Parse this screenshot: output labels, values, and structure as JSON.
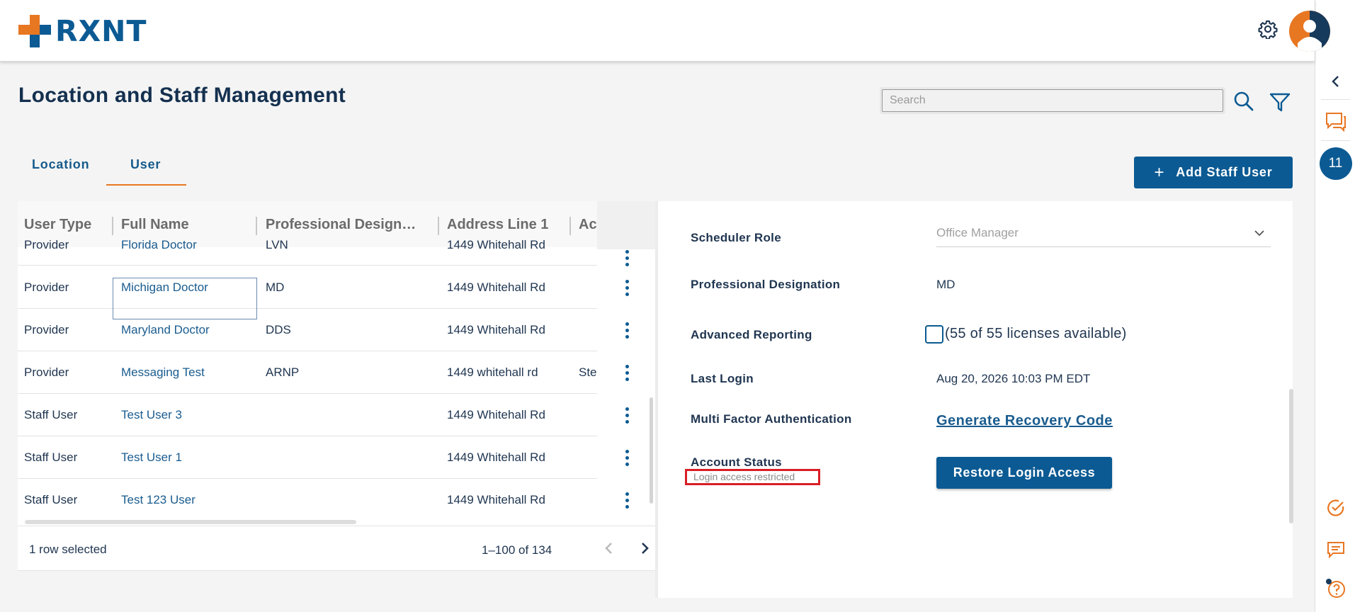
{
  "brand": {
    "logo_text": "RXNT",
    "cross_orange": "#e87722",
    "cross_blue": "#0b5a93"
  },
  "header": {
    "settings_icon": "gear-icon",
    "avatar_icon": "user-avatar-icon"
  },
  "page": {
    "title": "Location and Staff Management"
  },
  "search": {
    "placeholder": "Search"
  },
  "tabs": [
    {
      "label": "Location"
    },
    {
      "label": "User",
      "active": true
    }
  ],
  "add_button": {
    "plus": "+",
    "label": "Add Staff User"
  },
  "table": {
    "columns": [
      "User Type",
      "Full Name",
      "Professional Design…",
      "Address Line 1",
      "Ac"
    ],
    "rows": [
      {
        "user_type": "Provider",
        "full_name": "Florida Doctor",
        "designation": "LVN",
        "address1": "1449 Whitehall Rd",
        "address2": ""
      },
      {
        "user_type": "Provider",
        "full_name": "Michigan Doctor",
        "designation": "MD",
        "address1": "1449 Whitehall Rd",
        "address2": ""
      },
      {
        "user_type": "Provider",
        "full_name": "Maryland Doctor",
        "designation": "DDS",
        "address1": "1449 Whitehall Rd",
        "address2": ""
      },
      {
        "user_type": "Provider",
        "full_name": "Messaging Test",
        "designation": "ARNP",
        "address1": "1449 whitehall rd",
        "address2": "Ste"
      },
      {
        "user_type": "Staff User",
        "full_name": "Test User 3",
        "designation": "",
        "address1": "1449 Whitehall Rd",
        "address2": ""
      },
      {
        "user_type": "Staff User",
        "full_name": "Test User 1",
        "designation": "",
        "address1": "1449 Whitehall Rd",
        "address2": ""
      },
      {
        "user_type": "Staff User",
        "full_name": "Test 123 User",
        "designation": "",
        "address1": "1449 Whitehall Rd",
        "address2": ""
      }
    ],
    "footer": {
      "selected": "1 row selected",
      "range": "1–100 of 134"
    }
  },
  "detail": {
    "scheduler_role": {
      "label": "Scheduler Role",
      "value": "Office Manager"
    },
    "professional_designation": {
      "label": "Professional Designation",
      "value": "MD"
    },
    "advanced_reporting": {
      "label": "Advanced Reporting",
      "licenses": "(55 of 55 licenses available)",
      "checked": false
    },
    "last_login": {
      "label": "Last Login",
      "value": "Aug 20, 2026 10:03 PM EDT"
    },
    "mfa": {
      "label": "Multi Factor Authentication",
      "link": "Generate Recovery Code"
    },
    "account_status": {
      "label": "Account Status",
      "status": "Login access restricted",
      "button": "Restore Login Access"
    }
  },
  "rail": {
    "collapse_icon": "chevron-left-icon",
    "chat_icon": "chat-icon",
    "badge": "11",
    "task_icon": "check-circle-icon",
    "message_icon": "message-icon",
    "help_icon": "help-icon"
  }
}
